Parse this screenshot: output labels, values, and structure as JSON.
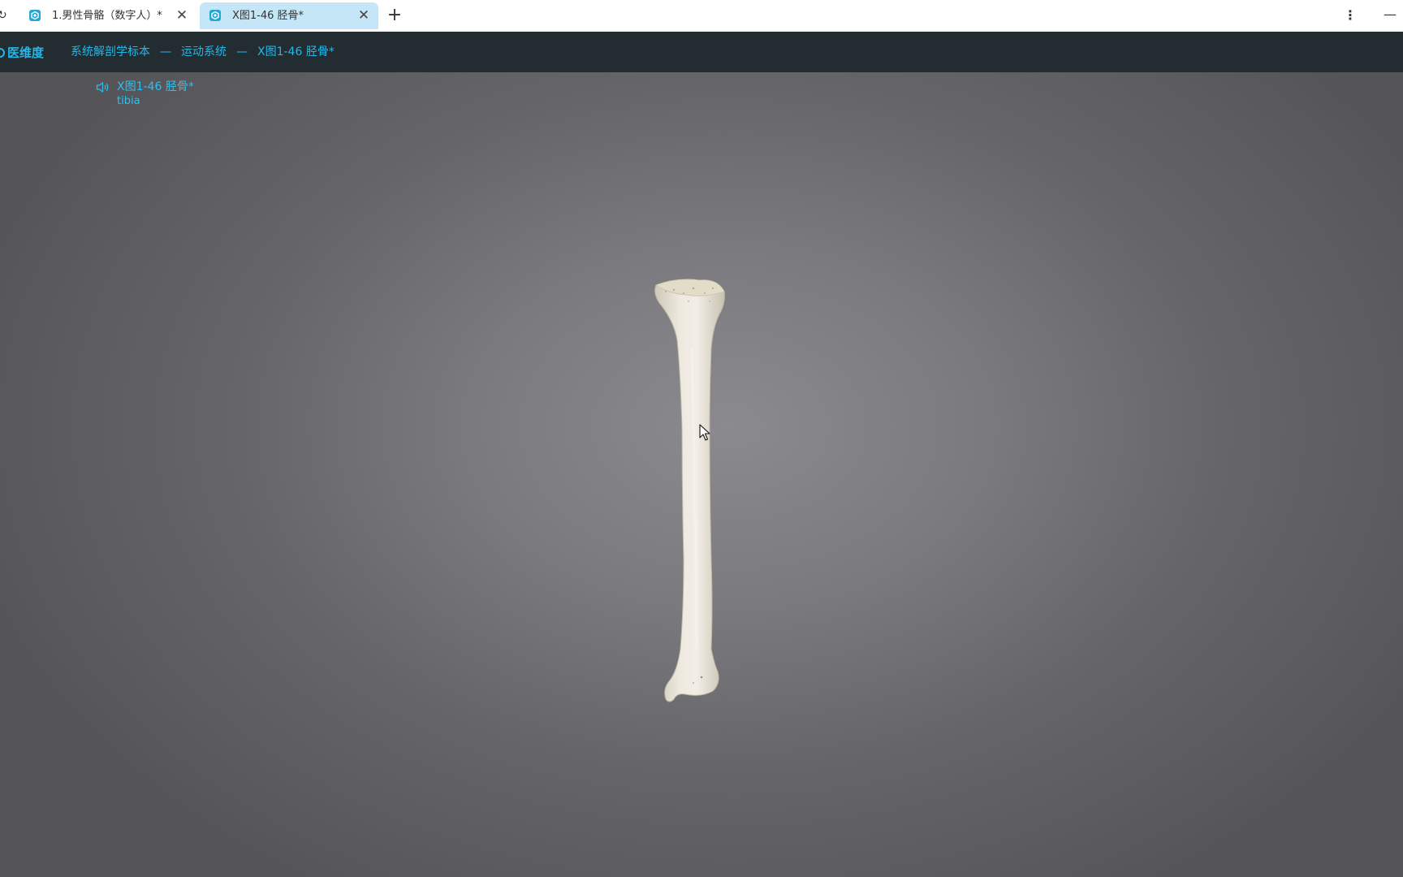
{
  "browser": {
    "tabs": [
      {
        "title": "1.男性骨骼（数字人）*",
        "active": false,
        "icon": "app-favicon-icon"
      },
      {
        "title": "X图1-46 胫骨*",
        "active": true,
        "icon": "app-favicon-icon"
      }
    ],
    "new_tab_label": "+",
    "close_glyph": "✕",
    "menu_glyph": "⋮",
    "minimize_glyph": "—",
    "reload_glyph": "↻"
  },
  "navbar": {
    "brand": "医维度",
    "breadcrumb": [
      "系统解剖学标本",
      "运动系统",
      "X图1-46 胫骨*"
    ],
    "separator": "—"
  },
  "viewer": {
    "label_name": "X图1-46 胫骨*",
    "label_latin": "tibia",
    "model": "tibia-bone-3d-model"
  },
  "colors": {
    "accent": "#22b8ea",
    "navbar_bg": "#232c31",
    "active_tab_bg": "#c5e6f7",
    "viewport_bg": "#7b7a7e",
    "bone": "#e7e2d6"
  }
}
